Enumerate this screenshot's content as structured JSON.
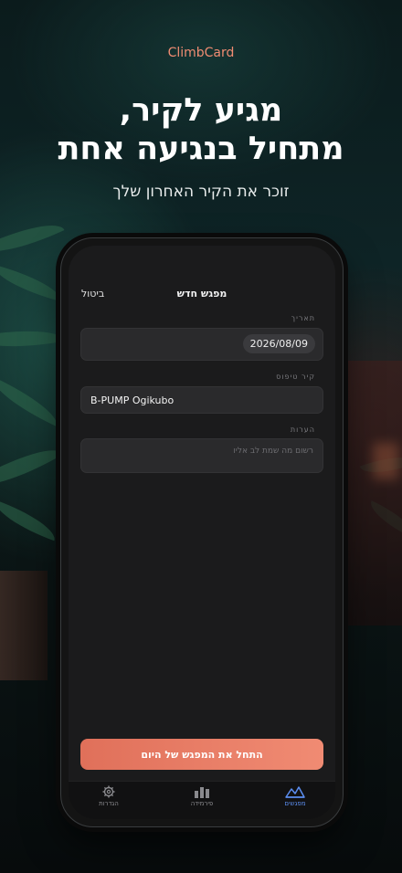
{
  "brand": "ClimbCard",
  "headline": {
    "line1": "מגיע לקיר,",
    "line2": "מתחיל בנגיעה אחת"
  },
  "subtitle": "זוכר את הקיר האחרון שלך",
  "screen": {
    "nav": {
      "title": "מפגש חדש",
      "cancel": "ביטול"
    },
    "date": {
      "label": "תאריך",
      "value": "2026/08/09"
    },
    "wall": {
      "label": "קיר טיפוס",
      "value": "B-PUMP Ogikubo"
    },
    "notes": {
      "label": "הערות",
      "placeholder": "רשום מה שמת לב אליו"
    },
    "cta": "התחל את המפגש של היום",
    "tabs": [
      {
        "label": "מפגשים",
        "icon": "mountains-icon",
        "active": true
      },
      {
        "label": "פירמידה",
        "icon": "bar-chart-icon",
        "active": false
      },
      {
        "label": "הגדרות",
        "icon": "gear-icon",
        "active": false
      }
    ]
  },
  "colors": {
    "accent": "#f08c72",
    "active_tab": "#5b8def",
    "screen_bg": "#1b1b1c"
  }
}
